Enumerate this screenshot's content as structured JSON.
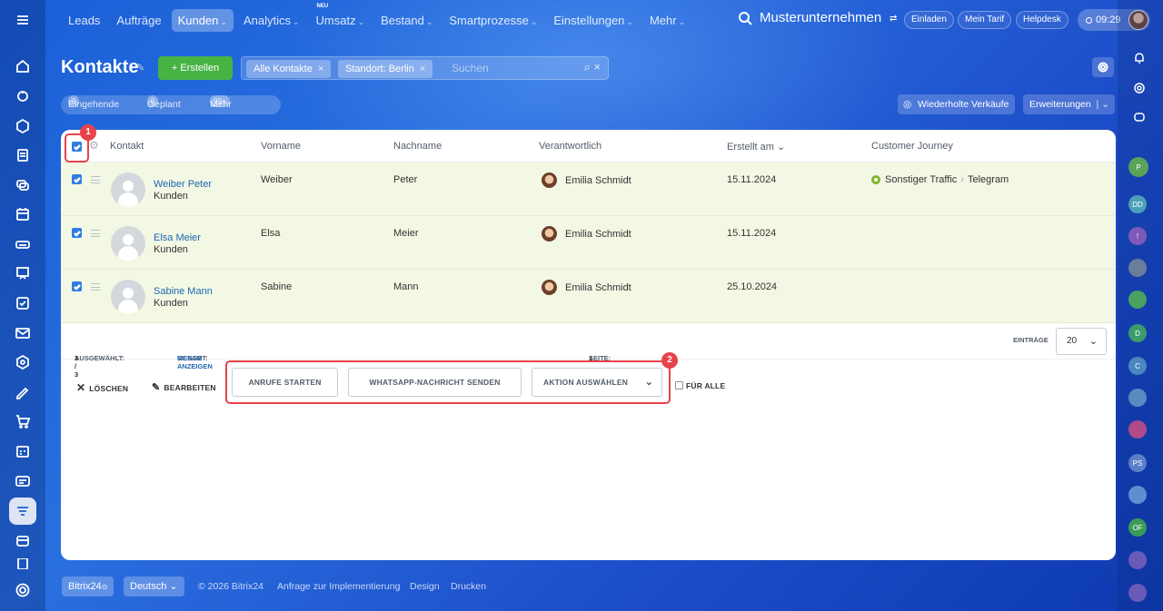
{
  "nav": {
    "items": [
      {
        "label": "Leads",
        "chevron": false,
        "active": false,
        "badge": ""
      },
      {
        "label": "Aufträge",
        "chevron": false,
        "active": false,
        "badge": ""
      },
      {
        "label": "Kunden",
        "chevron": true,
        "active": true,
        "badge": ""
      },
      {
        "label": "Analytics",
        "chevron": true,
        "active": false,
        "badge": ""
      },
      {
        "label": "Umsatz",
        "chevron": true,
        "active": false,
        "badge": "NEU"
      },
      {
        "label": "Bestand",
        "chevron": true,
        "active": false,
        "badge": ""
      },
      {
        "label": "Smartprozesse",
        "chevron": true,
        "active": false,
        "badge": ""
      },
      {
        "label": "Einstellungen",
        "chevron": true,
        "active": false,
        "badge": ""
      },
      {
        "label": "Mehr",
        "chevron": true,
        "active": false,
        "badge": ""
      }
    ],
    "company": "Musterunternehmen",
    "invite": "Einladen",
    "plan": "Mein Tarif",
    "helpdesk": "Helpdesk",
    "time": "09:29"
  },
  "page": {
    "title": "Kontakte",
    "create": "Erstellen",
    "filters": [
      "Alle Kontakte",
      "Standort: Berlin"
    ],
    "search_placeholder": "Suchen",
    "counters": {
      "incoming_count": "0",
      "incoming_label": "Eingehende",
      "planned_count": "0",
      "planned_label": "Geplant",
      "more_count": "99+",
      "more_label": "Mehr"
    },
    "repeat_sales": "Wiederholte Verkäufe",
    "extensions": "Erweiterungen"
  },
  "table": {
    "columns": {
      "contact": "Kontakt",
      "firstname": "Vorname",
      "lastname": "Nachname",
      "responsible": "Verantwortlich",
      "created": "Erstellt am",
      "journey": "Customer Journey"
    },
    "rows": [
      {
        "name": "Weiber Peter",
        "type": "Kunden",
        "first": "Weiber",
        "last": "Peter",
        "responsible": "Emilia Schmidt",
        "created": "15.11.2024",
        "journey": "Sonstiger Traffic",
        "journey_next": "Telegram"
      },
      {
        "name": "Elsa Meier",
        "type": "Kunden",
        "first": "Elsa",
        "last": "Meier",
        "responsible": "Emilia Schmidt",
        "created": "15.11.2024"
      },
      {
        "name": "Sabine Mann",
        "type": "Kunden",
        "first": "Sabine",
        "last": "Mann",
        "responsible": "Emilia Schmidt",
        "created": "25.10.2024"
      }
    ]
  },
  "summary": {
    "selected_label": "AUSGEWÄHLT:",
    "selected_value": "3 / 3",
    "total_label": "GESAMT:",
    "total_link": "MENGE ANZEIGEN",
    "page_label": "SEITE:",
    "page_value": "1",
    "entries_label": "EINTRÄGE",
    "entries_value": "20"
  },
  "actions": {
    "delete": "LÖSCHEN",
    "edit": "BEARBEITEN",
    "calls": "ANRUFE STARTEN",
    "whatsapp": "WHATSAPP-NACHRICHT SENDEN",
    "choose": "AKTION AUSWÄHLEN",
    "for_all": "FÜR ALLE"
  },
  "annotations": {
    "one": "1",
    "two": "2"
  },
  "footer": {
    "brand": "Bitrix24",
    "language": "Deutsch",
    "copyright": "© 2026 Bitrix24",
    "request": "Anfrage zur Implementierung",
    "design": "Design",
    "print": "Drucken"
  },
  "colors": {
    "accent": "#2f7de0",
    "create": "#46b343",
    "highlight": "#e8424a",
    "row_selected": "#f2f8e4"
  }
}
